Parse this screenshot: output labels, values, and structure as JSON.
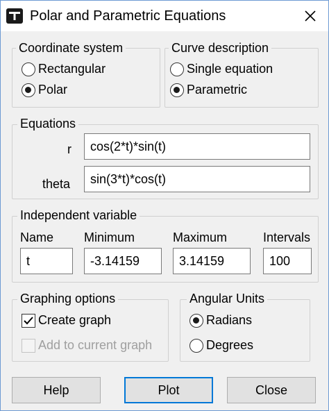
{
  "window": {
    "title": "Polar and Parametric Equations"
  },
  "coordinate_system": {
    "label": "Coordinate system",
    "options": [
      {
        "label": "Rectangular",
        "selected": false
      },
      {
        "label": "Polar",
        "selected": true
      }
    ]
  },
  "curve_description": {
    "label": "Curve description",
    "options": [
      {
        "label": "Single equation",
        "selected": false
      },
      {
        "label": "Parametric",
        "selected": true
      }
    ]
  },
  "equations": {
    "label": "Equations",
    "r": {
      "label": "r",
      "value": "cos(2*t)*sin(t)"
    },
    "theta": {
      "label": "theta",
      "value": "sin(3*t)*cos(t)"
    }
  },
  "independent_variable": {
    "label": "Independent variable",
    "name": {
      "label": "Name",
      "value": "t"
    },
    "minimum": {
      "label": "Minimum",
      "value": "-3.14159"
    },
    "maximum": {
      "label": "Maximum",
      "value": "3.14159"
    },
    "intervals": {
      "label": "Intervals",
      "value": "100"
    }
  },
  "graphing_options": {
    "label": "Graphing options",
    "create_graph": {
      "label": "Create graph",
      "checked": true
    },
    "add_to_current": {
      "label": "Add to current graph",
      "checked": false,
      "enabled": false
    }
  },
  "angular_units": {
    "label": "Angular Units",
    "options": [
      {
        "label": "Radians",
        "selected": true
      },
      {
        "label": "Degrees",
        "selected": false
      }
    ]
  },
  "buttons": {
    "help": "Help",
    "plot": "Plot",
    "close": "Close"
  }
}
